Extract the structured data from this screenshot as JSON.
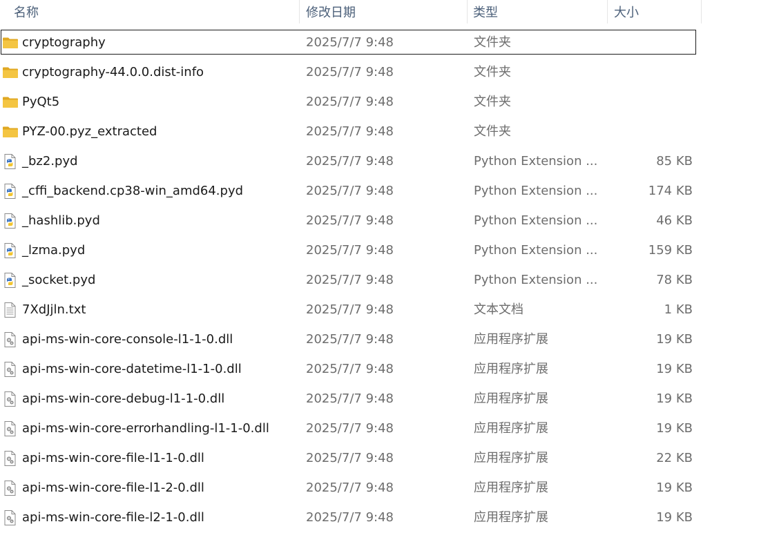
{
  "columns": {
    "name": "名称",
    "date": "修改日期",
    "type": "类型",
    "size": "大小"
  },
  "files": [
    {
      "icon": "folder-icon",
      "name": "cryptography",
      "date": "2025/7/7 9:48",
      "type": "文件夹",
      "size": ""
    },
    {
      "icon": "folder-icon",
      "name": "cryptography-44.0.0.dist-info",
      "date": "2025/7/7 9:48",
      "type": "文件夹",
      "size": ""
    },
    {
      "icon": "folder-icon",
      "name": "PyQt5",
      "date": "2025/7/7 9:48",
      "type": "文件夹",
      "size": ""
    },
    {
      "icon": "folder-icon",
      "name": "PYZ-00.pyz_extracted",
      "date": "2025/7/7 9:48",
      "type": "文件夹",
      "size": ""
    },
    {
      "icon": "python-file-icon",
      "name": "_bz2.pyd",
      "date": "2025/7/7 9:48",
      "type": "Python Extension ...",
      "size": "85 KB"
    },
    {
      "icon": "python-file-icon",
      "name": "_cffi_backend.cp38-win_amd64.pyd",
      "date": "2025/7/7 9:48",
      "type": "Python Extension ...",
      "size": "174 KB"
    },
    {
      "icon": "python-file-icon",
      "name": "_hashlib.pyd",
      "date": "2025/7/7 9:48",
      "type": "Python Extension ...",
      "size": "46 KB"
    },
    {
      "icon": "python-file-icon",
      "name": "_lzma.pyd",
      "date": "2025/7/7 9:48",
      "type": "Python Extension ...",
      "size": "159 KB"
    },
    {
      "icon": "python-file-icon",
      "name": "_socket.pyd",
      "date": "2025/7/7 9:48",
      "type": "Python Extension ...",
      "size": "78 KB"
    },
    {
      "icon": "text-file-icon",
      "name": "7XdJjln.txt",
      "date": "2025/7/7 9:48",
      "type": "文本文档",
      "size": "1 KB"
    },
    {
      "icon": "dll-file-icon",
      "name": "api-ms-win-core-console-l1-1-0.dll",
      "date": "2025/7/7 9:48",
      "type": "应用程序扩展",
      "size": "19 KB"
    },
    {
      "icon": "dll-file-icon",
      "name": "api-ms-win-core-datetime-l1-1-0.dll",
      "date": "2025/7/7 9:48",
      "type": "应用程序扩展",
      "size": "19 KB"
    },
    {
      "icon": "dll-file-icon",
      "name": "api-ms-win-core-debug-l1-1-0.dll",
      "date": "2025/7/7 9:48",
      "type": "应用程序扩展",
      "size": "19 KB"
    },
    {
      "icon": "dll-file-icon",
      "name": "api-ms-win-core-errorhandling-l1-1-0.dll",
      "date": "2025/7/7 9:48",
      "type": "应用程序扩展",
      "size": "19 KB"
    },
    {
      "icon": "dll-file-icon",
      "name": "api-ms-win-core-file-l1-1-0.dll",
      "date": "2025/7/7 9:48",
      "type": "应用程序扩展",
      "size": "22 KB"
    },
    {
      "icon": "dll-file-icon",
      "name": "api-ms-win-core-file-l1-2-0.dll",
      "date": "2025/7/7 9:48",
      "type": "应用程序扩展",
      "size": "19 KB"
    },
    {
      "icon": "dll-file-icon",
      "name": "api-ms-win-core-file-l2-1-0.dll",
      "date": "2025/7/7 9:48",
      "type": "应用程序扩展",
      "size": "19 KB"
    }
  ],
  "focused_index": 0,
  "colors": {
    "folder": "#f4c542",
    "folder_dark": "#e0a823",
    "header_text": "#4c607a",
    "secondary_text": "#6d6d6d"
  }
}
